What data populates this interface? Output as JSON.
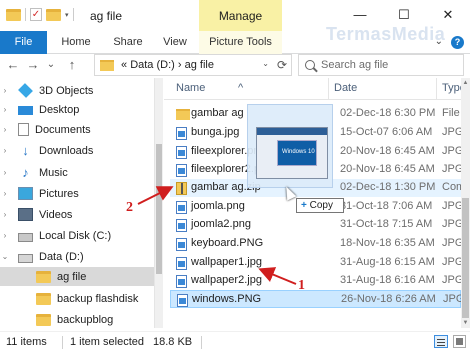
{
  "window": {
    "title": "ag file",
    "manage_tab": "Manage",
    "controls": [
      "—",
      "☐",
      "✕"
    ]
  },
  "ribbon": {
    "tabs": [
      "File",
      "Home",
      "Share",
      "View",
      "Picture Tools"
    ],
    "collapse": "⌄",
    "help": "?"
  },
  "nav": {
    "back": "←",
    "forward": "→",
    "dropdown": "⌄",
    "up": "↑"
  },
  "address": {
    "prefix": "«",
    "path": "Data (D:)",
    "sep": "›",
    "current": "ag file",
    "dropdown": "⌄",
    "refresh": "⟳"
  },
  "search": {
    "placeholder": "Search ag file"
  },
  "sidebar": {
    "items": [
      {
        "label": "3D Objects"
      },
      {
        "label": "Desktop"
      },
      {
        "label": "Documents"
      },
      {
        "label": "Downloads"
      },
      {
        "label": "Music"
      },
      {
        "label": "Pictures"
      },
      {
        "label": "Videos"
      },
      {
        "label": "Local Disk (C:)"
      },
      {
        "label": "Data (D:)"
      },
      {
        "label": "ag file"
      },
      {
        "label": "backup flashdisk"
      },
      {
        "label": "backupblog"
      }
    ]
  },
  "columns": {
    "name": "Name",
    "date": "Date",
    "type": "Type"
  },
  "files": [
    {
      "name": "gambar ag",
      "date": "02-Dec-18 6:30 PM",
      "type": "File fo"
    },
    {
      "name": "bunga.jpg",
      "date": "15-Oct-07 6:06 AM",
      "type": "JPG Fi"
    },
    {
      "name": "fileexplorer.png",
      "date": "20-Nov-18 6:45 AM",
      "type": "JPG Fi"
    },
    {
      "name": "fileexplorer2.png",
      "date": "20-Nov-18 6:45 AM",
      "type": "JPG Fi"
    },
    {
      "name": "gambar ag.zip",
      "date": "02-Dec-18 1:30 PM",
      "type": "Comp"
    },
    {
      "name": "joomla.png",
      "date": "31-Oct-18 7:06 AM",
      "type": "JPG Fi"
    },
    {
      "name": "joomla2.png",
      "date": "31-Oct-18 7:15 AM",
      "type": "JPG Fi"
    },
    {
      "name": "keyboard.PNG",
      "date": "18-Nov-18 6:35 AM",
      "type": "JPG Fi"
    },
    {
      "name": "wallpaper1.jpg",
      "date": "31-Aug-18 6:15 AM",
      "type": "JPG Fi"
    },
    {
      "name": "wallpaper2.jpg",
      "date": "31-Aug-18 6:16 AM",
      "type": "JPG Fi"
    },
    {
      "name": "windows.PNG",
      "date": "26-Nov-18 6:26 AM",
      "type": "JPG Fi"
    }
  ],
  "drag": {
    "preview_label": "Windows 10",
    "tooltip_symbol": "+",
    "tooltip_text": "Copy"
  },
  "annotations": {
    "one": "1",
    "two": "2",
    "watermark": "TermasMedia"
  },
  "status": {
    "items": "11 items",
    "selected": "1 item selected",
    "size": "18.8 KB"
  }
}
